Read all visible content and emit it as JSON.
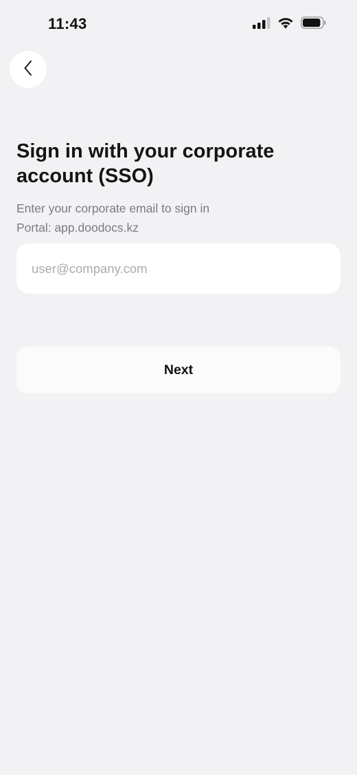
{
  "status_bar": {
    "time": "11:43",
    "icons": [
      "cellular-signal-icon",
      "wifi-icon",
      "battery-icon"
    ]
  },
  "header": {
    "back_icon": "chevron-left-icon"
  },
  "main": {
    "title": "Sign in with your corporate account (SSO)",
    "subtitle_line1": "Enter your corporate email to sign in",
    "subtitle_line2": "Portal: app.doodocs.kz",
    "email": {
      "value": "",
      "placeholder": "user@company.com"
    },
    "next_label": "Next"
  },
  "colors": {
    "background": "#f2f2f5",
    "surface": "#ffffff",
    "title_text": "#151515",
    "secondary_text": "#7b7b80",
    "placeholder_text": "#ababb0"
  }
}
